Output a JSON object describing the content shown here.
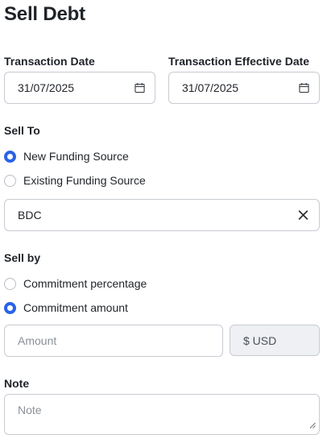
{
  "page": {
    "title": "Sell Debt"
  },
  "transaction_date": {
    "label": "Transaction Date",
    "value": "31/07/2025",
    "icon": "calendar-icon"
  },
  "transaction_effective_date": {
    "label": "Transaction Effective Date",
    "value": "31/07/2025",
    "icon": "calendar-icon"
  },
  "sell_to": {
    "label": "Sell To",
    "options": [
      {
        "label": "New Funding Source",
        "checked": true
      },
      {
        "label": "Existing Funding Source",
        "checked": false
      }
    ],
    "funding_source": {
      "value": "BDC",
      "clear_icon": "close-icon"
    }
  },
  "sell_by": {
    "label": "Sell by",
    "options": [
      {
        "label": "Commitment percentage",
        "checked": false
      },
      {
        "label": "Commitment amount",
        "checked": true
      }
    ],
    "amount": {
      "placeholder": "Amount",
      "value": ""
    },
    "currency": "$ USD"
  },
  "note": {
    "label": "Note",
    "placeholder": "Note",
    "value": ""
  },
  "colors": {
    "accent": "#2962e8",
    "border": "#c7cbd1",
    "disabled_bg": "#eef0f3"
  }
}
